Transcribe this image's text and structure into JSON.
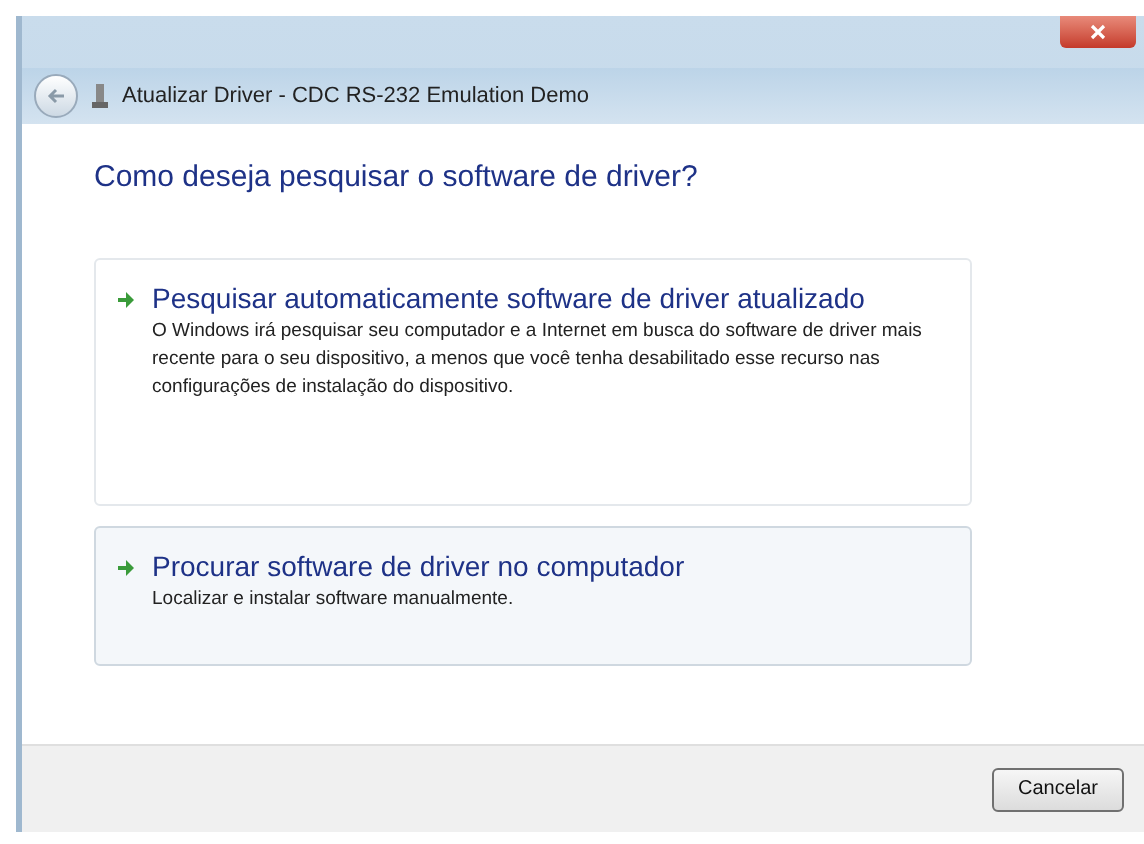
{
  "window": {
    "title": "Atualizar Driver - CDC RS-232 Emulation Demo"
  },
  "heading": "Como deseja pesquisar o software de driver?",
  "options": [
    {
      "title": "Pesquisar automaticamente software de driver atualizado",
      "description": "O Windows irá pesquisar seu computador e a Internet em busca do software de driver mais recente para o seu dispositivo, a menos que você tenha desabilitado esse recurso nas configurações de instalação do dispositivo.",
      "highlighted": false
    },
    {
      "title": "Procurar software de driver no computador",
      "description": "Localizar e instalar software manualmente.",
      "highlighted": true
    }
  ],
  "buttons": [
    "Cancelar"
  ]
}
